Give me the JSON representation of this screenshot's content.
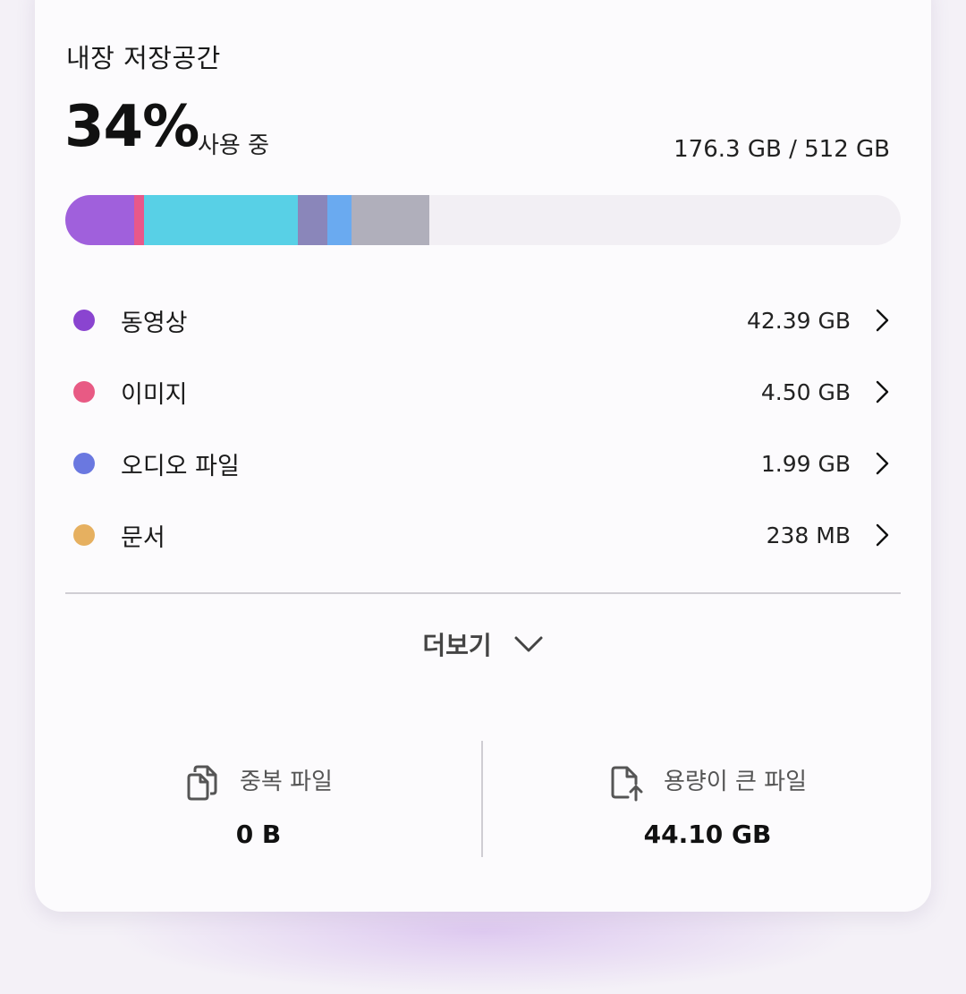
{
  "storage": {
    "title": "내장 저장공간",
    "percent": "34%",
    "in_use_label": "사용 중",
    "capacity": "176.3 GB / 512 GB"
  },
  "usage_bar": {
    "segments": [
      {
        "color": "#a060dc",
        "percent": 8.2
      },
      {
        "color": "#e8588a",
        "percent": 1.2
      },
      {
        "color": "#58d0e6",
        "percent": 18.4
      },
      {
        "color": "#8a86ba",
        "percent": 3.6
      },
      {
        "color": "#6aaaf0",
        "percent": 2.9
      },
      {
        "color": "#b0afbb",
        "percent": 9.3
      }
    ],
    "track_color": "#f2eff4"
  },
  "categories": [
    {
      "label": "동영상",
      "size": "42.39 GB",
      "color": "#8a44d0",
      "icon": "chevron-right-icon"
    },
    {
      "label": "이미지",
      "size": "4.50 GB",
      "color": "#e85a84",
      "icon": "chevron-right-icon"
    },
    {
      "label": "오디오 파일",
      "size": "1.99 GB",
      "color": "#6a78e0",
      "icon": "chevron-right-icon"
    },
    {
      "label": "문서",
      "size": "238 MB",
      "color": "#e6b060",
      "icon": "chevron-right-icon"
    }
  ],
  "more": {
    "label": "더보기",
    "icon": "chevron-down-icon"
  },
  "duplicate_files": {
    "label": "중복 파일",
    "value": "0 B",
    "icon": "copy-files-icon"
  },
  "large_files": {
    "label": "용량이 큰 파일",
    "value": "44.10 GB",
    "icon": "file-upload-icon"
  }
}
